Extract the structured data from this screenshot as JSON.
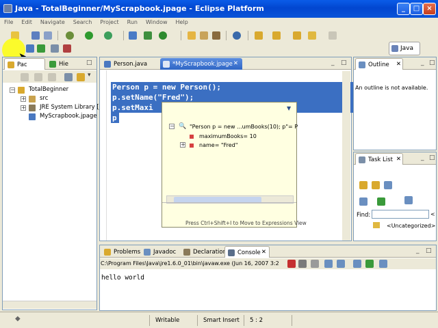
{
  "window": {
    "title": "Java - TotalBeginner/MyScrapbook.jpage - Eclipse Platform"
  },
  "menu": [
    "File",
    "Edit",
    "Navigate",
    "Search",
    "Project",
    "Run",
    "Window",
    "Help"
  ],
  "perspective": {
    "label": "Java"
  },
  "left_panel": {
    "tabs": [
      {
        "label": "Pac"
      },
      {
        "label": "Hie"
      }
    ],
    "tree": {
      "project": "TotalBeginner",
      "src": "src",
      "jre": "JRE System Library [j",
      "file": "MyScrapbook.jpage"
    }
  },
  "editor": {
    "tabs": [
      {
        "label": "Person.java"
      },
      {
        "label": "*MyScrapbook.jpage"
      }
    ],
    "lines": [
      "Person p = new Person();",
      "p.setName(\"Fred\");",
      "p.setMaxi",
      "p"
    ]
  },
  "inspect_popup": {
    "root": "\"Person p = new ...umBooks(10);  p\"= P",
    "children": [
      "maximumBooks= 10",
      "name= \"Fred\""
    ],
    "hint": "Press Ctrl+Shift+I to Move to Expressions View"
  },
  "outline": {
    "tab": "Outline",
    "message": "An outline is not available."
  },
  "tasklist": {
    "tab": "Task List",
    "find_label": "Find:",
    "uncategorized": "<Uncategorized>"
  },
  "bottom_panel": {
    "tabs": [
      {
        "label": "Problems"
      },
      {
        "label": "Javadoc"
      },
      {
        "label": "Declaration"
      },
      {
        "label": "Console"
      }
    ],
    "console_header": "C:\\Program Files\\Java\\jre1.6.0_01\\bin\\javaw.exe (Jun 16, 2007 3:2",
    "output": "hello world"
  },
  "status": {
    "writable": "Writable",
    "insert_mode": "Smart Insert",
    "position": "5 : 2"
  }
}
